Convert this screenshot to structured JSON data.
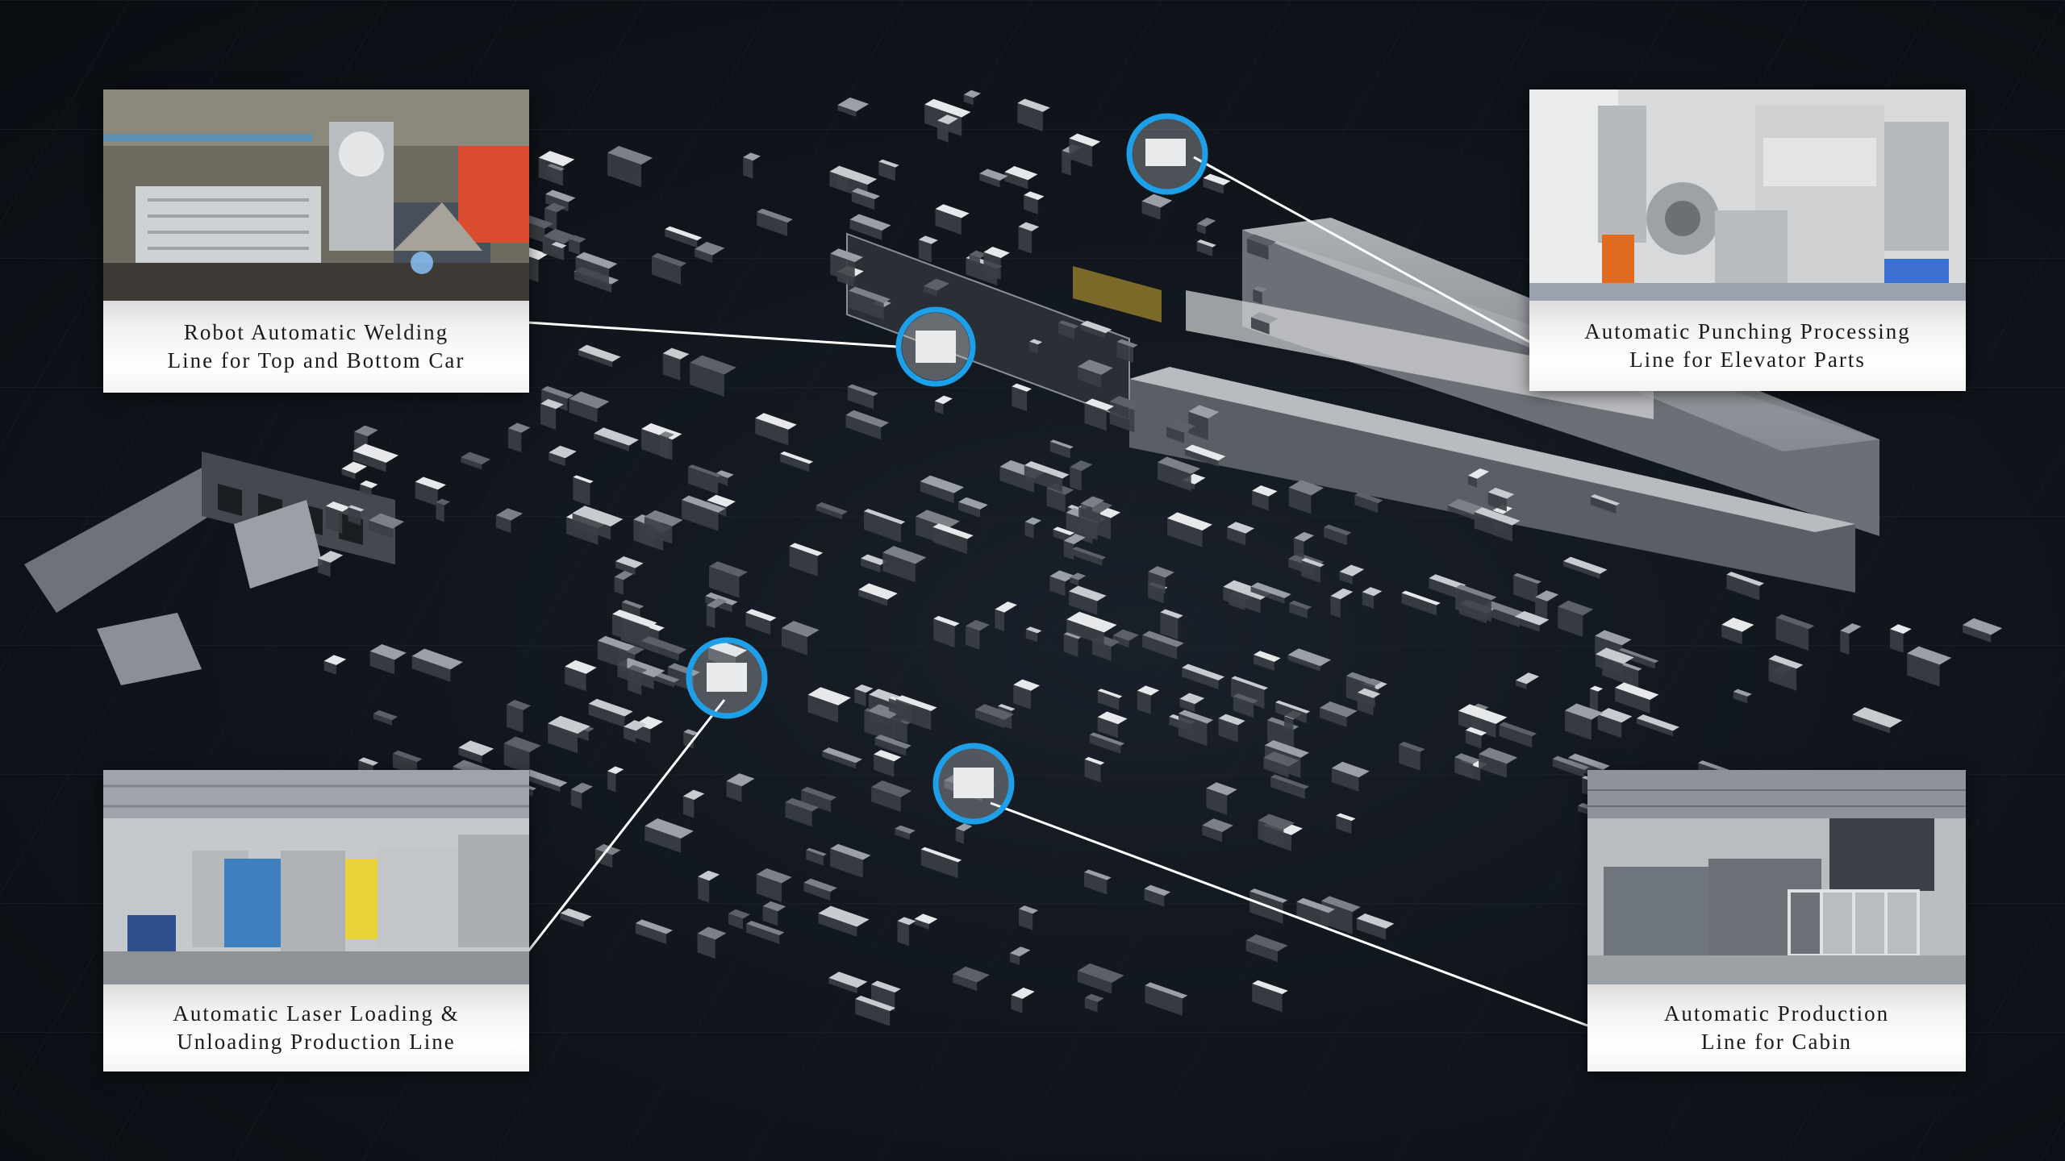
{
  "colors": {
    "background": "#11161d",
    "marker_ring": "#1ea0e8",
    "connector_line": "#ffffff",
    "caption_text": "#1a1a1a",
    "equipment_light": "#e6e8ea",
    "equipment_mid": "#9aa0a6",
    "equipment_dark": "#3a3f45"
  },
  "callouts": [
    {
      "id": "welding",
      "title_line1": "Robot Automatic Welding",
      "title_line2": "Line for Top and Bottom Car",
      "photo_icon": "welding-robot-photo"
    },
    {
      "id": "punching",
      "title_line1": "Automatic Punching Processing",
      "title_line2": "Line for Elevator Parts",
      "photo_icon": "punch-press-photo"
    },
    {
      "id": "laser",
      "title_line1": "Automatic Laser Loading &",
      "title_line2": "Unloading Production Line",
      "photo_icon": "laser-cutter-photo"
    },
    {
      "id": "cabin",
      "title_line1": "Automatic Production",
      "title_line2": "Line for Cabin",
      "photo_icon": "press-brake-cell-photo"
    }
  ]
}
